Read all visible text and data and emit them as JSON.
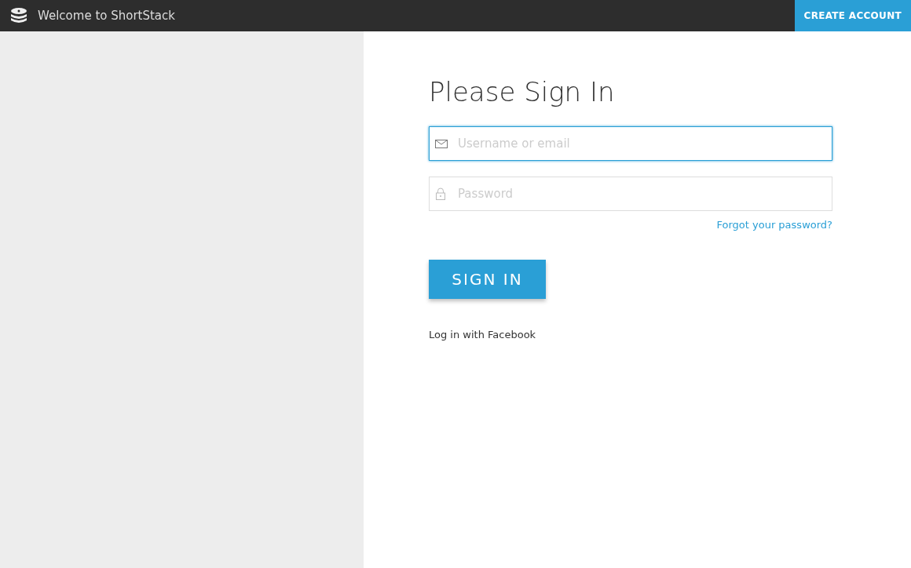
{
  "header": {
    "title": "Welcome to ShortStack",
    "action": "CREATE ACCOUNT"
  },
  "form": {
    "heading": "Please Sign In",
    "fields": [
      {
        "kind": "email",
        "placeholder": "Username or email",
        "focused": true
      },
      {
        "kind": "password",
        "placeholder": "Password",
        "focused": false
      }
    ],
    "forgot_link": "Forgot your password?",
    "submit": "SIGN IN",
    "facebook_link": "Log in with Facebook"
  }
}
